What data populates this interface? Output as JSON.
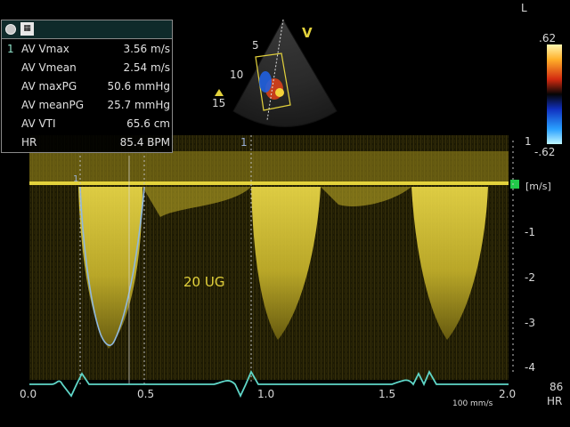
{
  "corner": {
    "orientation": "L"
  },
  "measurements": {
    "index": "1",
    "rows": [
      {
        "label": "AV Vmax",
        "value": "3.56 m/s"
      },
      {
        "label": "AV Vmean",
        "value": "2.54 m/s"
      },
      {
        "label": "AV maxPG",
        "value": "50.6 mmHg"
      },
      {
        "label": "AV meanPG",
        "value": "25.7 mmHg"
      },
      {
        "label": "AV VTI",
        "value": "65.6 cm"
      },
      {
        "label": "HR",
        "value": "85.4 BPM"
      }
    ]
  },
  "color_bar": {
    "top": ".62",
    "bottom": "-.62"
  },
  "sector": {
    "marker": "V",
    "depths": [
      "5",
      "10",
      "15"
    ]
  },
  "doppler": {
    "gain": "20 UG",
    "velocity_unit": "[m/s]",
    "velocity_ticks": [
      "1",
      "-1",
      "-2",
      "-3",
      "-4"
    ],
    "time_ticks": [
      "0.0",
      "0.5",
      "1.0",
      "1.5",
      "2.0"
    ],
    "sweep_speed": "100 mm/s",
    "cursor_label": "1",
    "caliper_label": "1"
  },
  "heart_rate": {
    "value": "86",
    "unit": "HR"
  },
  "colors": {
    "spectral": "#e3d23c",
    "ecg": "#5fd6c8",
    "trace": "#8fb8e0"
  }
}
